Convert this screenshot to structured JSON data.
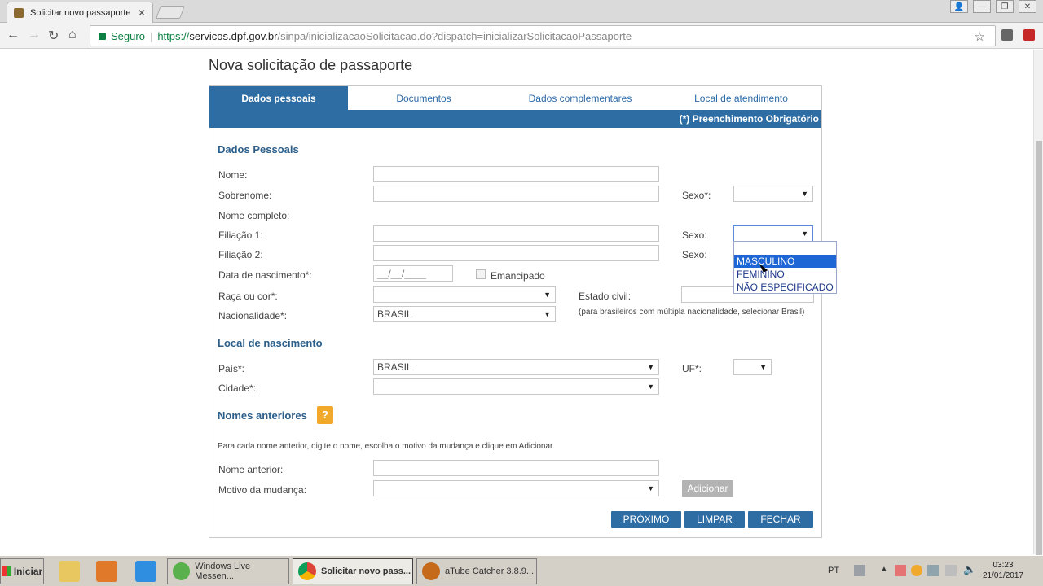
{
  "browser": {
    "tab_title": "Solicitar novo passaporte -",
    "secure_label": "Seguro",
    "url_proto": "https://",
    "url_host": "servicos.dpf.gov.br",
    "url_path": "/sinpa/inicializacaoSolicitacao.do?dispatch=inicializarSolicitacaoPassaporte"
  },
  "page": {
    "title": "Nova solicitação de passaporte",
    "tabs": [
      "Dados pessoais",
      "Documentos",
      "Dados complementares",
      "Local de atendimento"
    ],
    "required_note": "(*) Preenchimento Obrigatório"
  },
  "form": {
    "section_personal": "Dados Pessoais",
    "nome": "Nome:",
    "sobrenome": "Sobrenome:",
    "sexo_req": "Sexo*:",
    "nome_completo": "Nome completo:",
    "filiacao1": "Filiação 1:",
    "sexo1": "Sexo:",
    "filiacao2": "Filiação 2:",
    "sexo2": "Sexo:",
    "data_nascimento": "Data de nascimento*:",
    "date_placeholder": "__/__/____",
    "emancipado": "Emancipado",
    "raca": "Raça ou cor*:",
    "estado_civil": "Estado civil:",
    "nacionalidade": "Nacionalidade*:",
    "nacionalidade_value": "BRASIL",
    "nacionalidade_note": "(para brasileiros com múltipla nacionalidade, selecionar Brasil)",
    "section_birthplace": "Local de nascimento",
    "pais": "País*:",
    "pais_value": "BRASIL",
    "uf": "UF*:",
    "cidade": "Cidade*:",
    "section_previous_names": "Nomes anteriores",
    "help_glyph": "?",
    "previous_names_hint": "Para cada nome anterior, digite o nome, escolha o motivo da mudança e clique em Adicionar.",
    "nome_anterior": "Nome anterior:",
    "motivo": "Motivo da mudança:",
    "adicionar": "Adicionar"
  },
  "dropdown_options": [
    "MASCULINO",
    "FEMININO",
    "NÃO ESPECIFICADO"
  ],
  "buttons": {
    "proximo": "PRÓXIMO",
    "limpar": "LIMPAR",
    "fechar": "FECHAR"
  },
  "taskbar": {
    "start": "Iniciar",
    "task1": "Windows Live Messen...",
    "task2": "Solicitar novo pass...",
    "task3": "aTube Catcher 3.8.9...",
    "lang": "PT",
    "time": "03:23",
    "date": "21/01/2017"
  },
  "colors": {
    "primary": "#2e6da4",
    "help": "#f0a92a",
    "highlight": "#1e66d6"
  }
}
